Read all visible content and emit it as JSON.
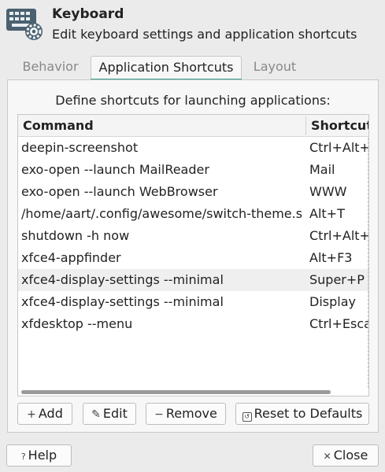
{
  "header": {
    "title": "Keyboard",
    "subtitle": "Edit keyboard settings and application shortcuts",
    "icon": "keyboard-settings-icon"
  },
  "tabs": [
    {
      "label": "Behavior",
      "active": false
    },
    {
      "label": "Application Shortcuts",
      "active": true
    },
    {
      "label": "Layout",
      "active": false
    }
  ],
  "accent_color": "#3a9a8c",
  "panel": {
    "caption": "Define shortcuts for launching applications:",
    "columns": {
      "command": "Command",
      "shortcut": "Shortcut"
    },
    "rows": [
      {
        "command": "deepin-screenshot",
        "shortcut": "Ctrl+Alt+I"
      },
      {
        "command": "exo-open --launch MailReader",
        "shortcut": "Mail"
      },
      {
        "command": "exo-open --launch WebBrowser",
        "shortcut": "WWW"
      },
      {
        "command": "/home/aart/.config/awesome/switch-theme.sh",
        "shortcut": "Alt+T"
      },
      {
        "command": "shutdown -h now",
        "shortcut": "Ctrl+Alt+I"
      },
      {
        "command": "xfce4-appfinder",
        "shortcut": "Alt+F3"
      },
      {
        "command": "xfce4-display-settings --minimal",
        "shortcut": "Super+P"
      },
      {
        "command": "xfce4-display-settings --minimal",
        "shortcut": "Display"
      },
      {
        "command": "xfdesktop --menu",
        "shortcut": "Ctrl+Escape"
      }
    ],
    "selected_row": 6,
    "buttons": {
      "add": "Add",
      "edit": "Edit",
      "remove": "Remove",
      "reset": "Reset to Defaults"
    }
  },
  "footer": {
    "help": "Help",
    "close": "Close"
  }
}
